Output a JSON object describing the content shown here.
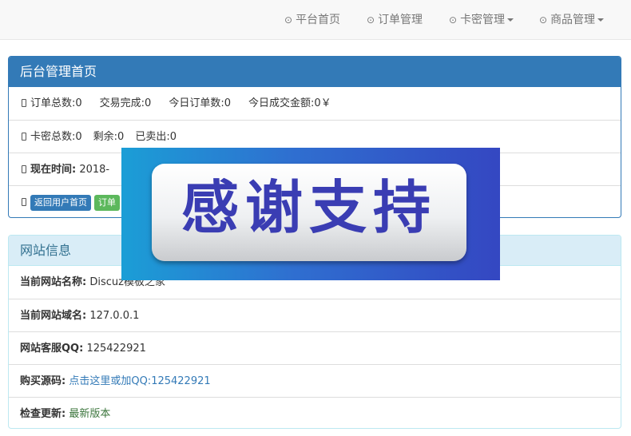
{
  "nav": {
    "home": "平台首页",
    "orders": "订单管理",
    "cards": "卡密管理",
    "products": "商品管理"
  },
  "panel_admin": {
    "title": "后台管理首页",
    "stats1": {
      "total_orders": "订单总数:0",
      "completed": "交易完成:0",
      "today_orders": "今日订单数:0",
      "today_amount": "今日成交金额:0￥"
    },
    "stats2": {
      "total_cards": "卡密总数:0",
      "remaining": "剩余:0",
      "sold": "已卖出:0"
    },
    "time": {
      "label": "现在时间:",
      "value": "2018-"
    },
    "buttons": {
      "back_home": "返回用户首页",
      "order_partial": "订单"
    }
  },
  "panel_site": {
    "title": "网站信息",
    "site_name": {
      "label": "当前网站名称:",
      "value": "Discuz模板之家"
    },
    "domain": {
      "label": "当前网站域名:",
      "value": "127.0.0.1"
    },
    "qq": {
      "label": "网站客服QQ:",
      "value": "125422921"
    },
    "buy": {
      "label": "购买源码:",
      "value": "点击这里或加QQ:125422921"
    },
    "update": {
      "label": "检查更新:",
      "value": "最新版本"
    }
  },
  "banner": {
    "text": "感谢支持"
  },
  "icons": {
    "nav": "circle-dot-icon",
    "row": "square-icon",
    "caret": "caret-down-icon"
  },
  "colors": {
    "primary": "#337ab7",
    "info_bg": "#d9edf7",
    "info_text": "#31708f",
    "success": "#5cb85c",
    "latest": "#3c763d"
  }
}
